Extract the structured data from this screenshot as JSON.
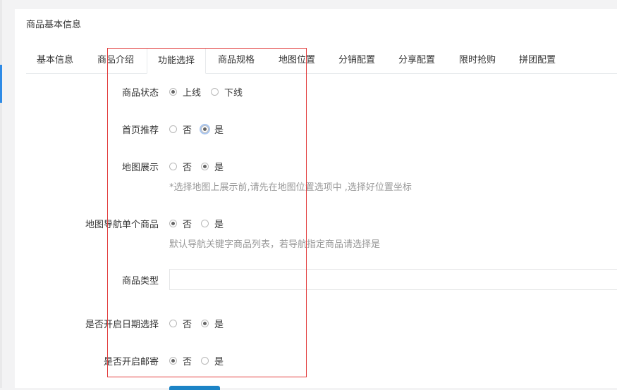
{
  "panel": {
    "title": "商品基本信息"
  },
  "tabs": [
    {
      "label": "基本信息"
    },
    {
      "label": "商品介绍"
    },
    {
      "label": "功能选择",
      "active": true
    },
    {
      "label": "商品规格"
    },
    {
      "label": "地图位置"
    },
    {
      "label": "分销配置"
    },
    {
      "label": "分享配置"
    },
    {
      "label": "限时抢购"
    },
    {
      "label": "拼团配置"
    }
  ],
  "form": {
    "status": {
      "label": "商品状态",
      "opt1": "上线",
      "opt2": "下线",
      "selected": "上线"
    },
    "recommend": {
      "label": "首页推荐",
      "opt1": "否",
      "opt2": "是",
      "selected": "是"
    },
    "map_show": {
      "label": "地图展示",
      "opt1": "否",
      "opt2": "是",
      "selected": "是",
      "hint": "*选择地图上展示前,请先在地图位置选项中 ,选择好位置坐标"
    },
    "map_nav": {
      "label": "地图导航单个商品",
      "opt1": "否",
      "opt2": "是",
      "selected": "否",
      "hint": "默认导航关键字商品列表，若导航指定商品请选择是"
    },
    "goods_type": {
      "label": "商品类型",
      "value": ""
    },
    "date_select": {
      "label": "是否开启日期选择",
      "opt1": "否",
      "opt2": "是",
      "selected": "是"
    },
    "mail": {
      "label": "是否开启邮寄",
      "opt1": "否",
      "opt2": "是",
      "selected": "否"
    }
  },
  "colors": {
    "accent": "#2f8be6",
    "highlight_box": "#e23b3b"
  }
}
